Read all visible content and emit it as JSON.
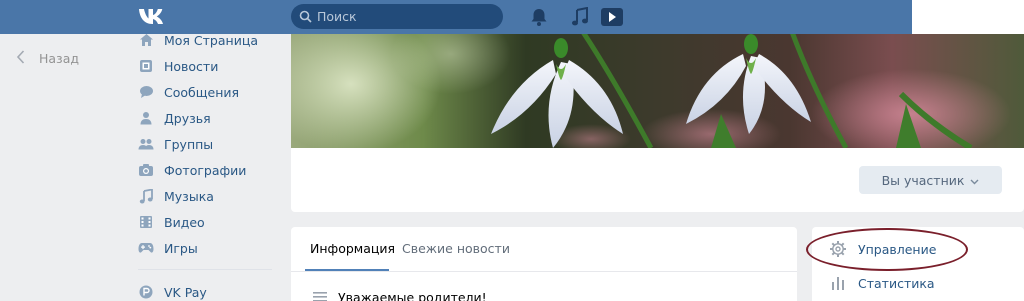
{
  "header": {
    "logo": "vk-logo",
    "search_placeholder": "Поиск",
    "icons": [
      "bell-icon",
      "music-note-icon",
      "play-icon"
    ]
  },
  "back": {
    "label": "Назад"
  },
  "sidebar": {
    "items": [
      {
        "label": "Моя Страница",
        "icon": "home-icon"
      },
      {
        "label": "Новости",
        "icon": "news-icon"
      },
      {
        "label": "Сообщения",
        "icon": "message-icon"
      },
      {
        "label": "Друзья",
        "icon": "user-icon"
      },
      {
        "label": "Группы",
        "icon": "group-icon"
      },
      {
        "label": "Фотографии",
        "icon": "camera-icon"
      },
      {
        "label": "Музыка",
        "icon": "music-icon"
      },
      {
        "label": "Видео",
        "icon": "video-icon"
      },
      {
        "label": "Игры",
        "icon": "gamepad-icon"
      }
    ],
    "extra": [
      {
        "label": "VK Pay",
        "icon": "vkpay-icon"
      }
    ]
  },
  "community": {
    "member_button": "Вы участник",
    "cover_image": "snowdrops-cover"
  },
  "tabs": {
    "info": "Информация",
    "news": "Свежие новости"
  },
  "post": {
    "text": "Уважаемые родители!"
  },
  "right_menu": {
    "manage": "Управление",
    "stats": "Статистика"
  },
  "colors": {
    "header": "#4a76a8",
    "link": "#2a5885",
    "highlight_oval": "#7a1f2b"
  }
}
